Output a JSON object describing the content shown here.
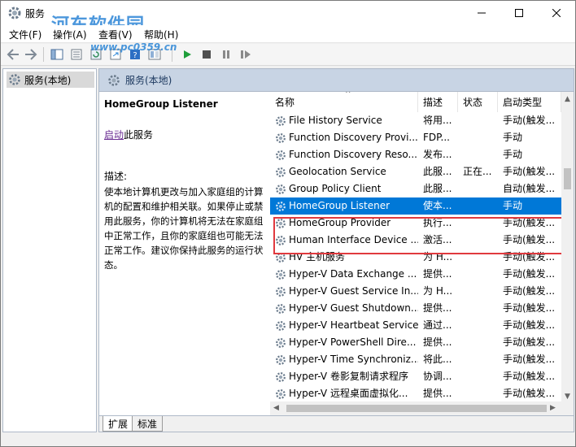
{
  "window": {
    "title": "服务",
    "watermark": "河东软件园",
    "watermark_url": "www.pc0359.cn"
  },
  "menu": [
    "文件(F)",
    "操作(A)",
    "查看(V)",
    "帮助(H)"
  ],
  "tree": {
    "root_label": "服务(本地)"
  },
  "main": {
    "header_label": "服务(本地)"
  },
  "desc": {
    "service_name": "HomeGroup Listener",
    "action_link": "启动",
    "action_suffix": "此服务",
    "desc_label": "描述:",
    "desc_text": "使本地计算机更改与加入家庭组的计算机的配置和维护相关联。如果停止或禁用此服务，你的计算机将无法在家庭组中正常工作，且你的家庭组也可能无法正常工作。建议你保持此服务的运行状态。"
  },
  "list": {
    "columns": [
      "名称",
      "描述",
      "状态",
      "启动类型"
    ],
    "rows": [
      {
        "name": "File History Service",
        "desc": "将用...",
        "status": "",
        "start": "手动(触发..."
      },
      {
        "name": "Function Discovery Provi...",
        "desc": "FDP...",
        "status": "",
        "start": "手动"
      },
      {
        "name": "Function Discovery Reso...",
        "desc": "发布...",
        "status": "",
        "start": "手动"
      },
      {
        "name": "Geolocation Service",
        "desc": "此服...",
        "status": "正在...",
        "start": "手动(触发..."
      },
      {
        "name": "Group Policy Client",
        "desc": "此服...",
        "status": "",
        "start": "自动(触发..."
      },
      {
        "name": "HomeGroup Listener",
        "desc": "使本...",
        "status": "",
        "start": "手动",
        "selected": true
      },
      {
        "name": "HomeGroup Provider",
        "desc": "执行...",
        "status": "",
        "start": "手动(触发..."
      },
      {
        "name": "Human Interface Device ...",
        "desc": "激活...",
        "status": "",
        "start": "手动(触发..."
      },
      {
        "name": "HV 主机服务",
        "desc": "为 H...",
        "status": "",
        "start": "手动(触发..."
      },
      {
        "name": "Hyper-V Data Exchange ...",
        "desc": "提供...",
        "status": "",
        "start": "手动(触发..."
      },
      {
        "name": "Hyper-V Guest Service In...",
        "desc": "为 H...",
        "status": "",
        "start": "手动(触发..."
      },
      {
        "name": "Hyper-V Guest Shutdown...",
        "desc": "提供...",
        "status": "",
        "start": "手动(触发..."
      },
      {
        "name": "Hyper-V Heartbeat Service",
        "desc": "通过...",
        "status": "",
        "start": "手动(触发..."
      },
      {
        "name": "Hyper-V PowerShell Dire...",
        "desc": "提供...",
        "status": "",
        "start": "手动(触发..."
      },
      {
        "name": "Hyper-V Time Synchroniz...",
        "desc": "将此...",
        "status": "",
        "start": "手动(触发..."
      },
      {
        "name": "Hyper-V 卷影复制请求程序",
        "desc": "协调...",
        "status": "",
        "start": "手动(触发..."
      },
      {
        "name": "Hyper-V 远程桌面虚拟化...",
        "desc": "提供...",
        "status": "",
        "start": "手动(触发..."
      }
    ]
  },
  "tabs": [
    "扩展",
    "标准"
  ],
  "colors": {
    "selection": "#0078d7",
    "highlight_border": "#e0393e",
    "header_bg": "#c8d4e4"
  }
}
